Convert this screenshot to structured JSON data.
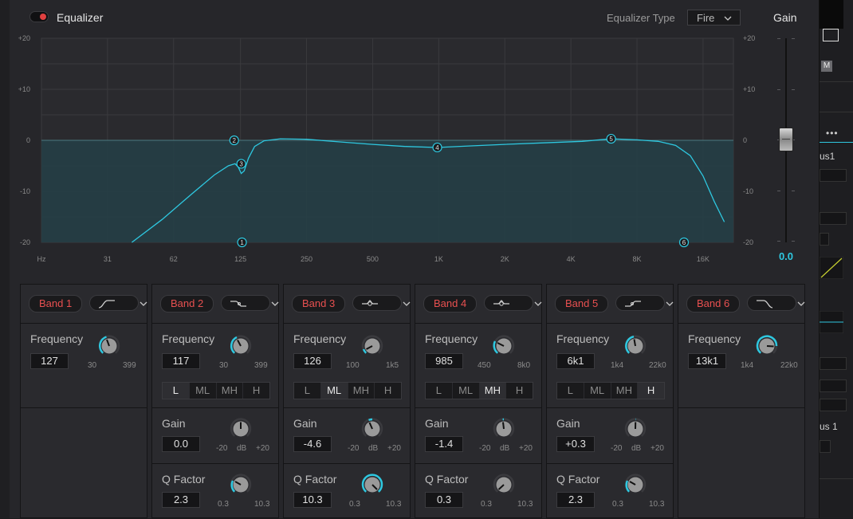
{
  "header": {
    "title": "Equalizer",
    "enabled": true,
    "eq_type_label": "Equalizer Type",
    "eq_type_value": "Fire",
    "gain_label": "Gain"
  },
  "graph": {
    "y_ticks_left": [
      "+20",
      "+10",
      "0",
      "-10",
      "-20"
    ],
    "y_ticks_right": [
      "+20",
      "+10",
      "0",
      "-10",
      "-20"
    ],
    "x_unit": "Hz",
    "x_ticks": [
      "31",
      "62",
      "125",
      "250",
      "500",
      "1K",
      "2K",
      "4K",
      "8K",
      "16K"
    ],
    "curve_color": "#2ec8e0",
    "markers": [
      {
        "id": "1",
        "freq_hz": 127,
        "gain_db": -20
      },
      {
        "id": "2",
        "freq_hz": 117,
        "gain_db": 0
      },
      {
        "id": "3",
        "freq_hz": 126,
        "gain_db": -4.6
      },
      {
        "id": "4",
        "freq_hz": 985,
        "gain_db": -1.4
      },
      {
        "id": "5",
        "freq_hz": 6100,
        "gain_db": 0.3
      },
      {
        "id": "6",
        "freq_hz": 13100,
        "gain_db": -20
      }
    ]
  },
  "gain_slider": {
    "value": "0.0",
    "value_db": 0
  },
  "bands": [
    {
      "label": "Band 1",
      "shape": "high-pass",
      "freq_label": "Frequency",
      "freq_value": "127",
      "freq_min": "30",
      "freq_max": "399"
    },
    {
      "label": "Band 2",
      "shape": "low-shelf",
      "freq_label": "Frequency",
      "freq_value": "117",
      "freq_min": "30",
      "freq_max": "399",
      "ranges": [
        "L",
        "ML",
        "MH",
        "H"
      ],
      "range_selected": "L",
      "gain_label": "Gain",
      "gain_value": "0.0",
      "gain_min": "-20",
      "gain_unit": "dB",
      "gain_max": "+20",
      "q_label": "Q Factor",
      "q_value": "2.3",
      "q_min": "0.3",
      "q_max": "10.3"
    },
    {
      "label": "Band 3",
      "shape": "bell",
      "freq_label": "Frequency",
      "freq_value": "126",
      "freq_min": "100",
      "freq_max": "1k5",
      "ranges": [
        "L",
        "ML",
        "MH",
        "H"
      ],
      "range_selected": "ML",
      "gain_label": "Gain",
      "gain_value": "-4.6",
      "gain_min": "-20",
      "gain_unit": "dB",
      "gain_max": "+20",
      "q_label": "Q Factor",
      "q_value": "10.3",
      "q_min": "0.3",
      "q_max": "10.3"
    },
    {
      "label": "Band 4",
      "shape": "bell",
      "freq_label": "Frequency",
      "freq_value": "985",
      "freq_min": "450",
      "freq_max": "8k0",
      "ranges": [
        "L",
        "ML",
        "MH",
        "H"
      ],
      "range_selected": "MH",
      "gain_label": "Gain",
      "gain_value": "-1.4",
      "gain_min": "-20",
      "gain_unit": "dB",
      "gain_max": "+20",
      "q_label": "Q Factor",
      "q_value": "0.3",
      "q_min": "0.3",
      "q_max": "10.3"
    },
    {
      "label": "Band 5",
      "shape": "high-shelf",
      "freq_label": "Frequency",
      "freq_value": "6k1",
      "freq_min": "1k4",
      "freq_max": "22k0",
      "ranges": [
        "L",
        "ML",
        "MH",
        "H"
      ],
      "range_selected": "H",
      "gain_label": "Gain",
      "gain_value": "+0.3",
      "gain_min": "-20",
      "gain_unit": "dB",
      "gain_max": "+20",
      "q_label": "Q Factor",
      "q_value": "2.3",
      "q_min": "0.3",
      "q_max": "10.3"
    },
    {
      "label": "Band 6",
      "shape": "low-pass",
      "freq_label": "Frequency",
      "freq_value": "13k1",
      "freq_min": "1k4",
      "freq_max": "22k0"
    }
  ],
  "right_strip": {
    "bus_top": "us1",
    "bus_mid": "us 1",
    "m_label": "M"
  }
}
